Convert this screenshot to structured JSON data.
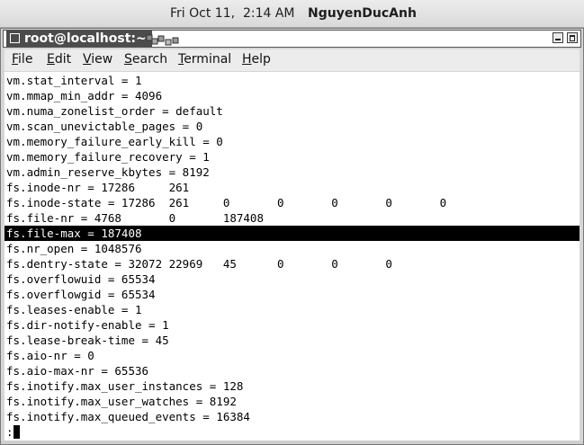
{
  "top_panel": {
    "clock": "Fri Oct 11,  2:14 AM",
    "username": "NguyenDucAnh"
  },
  "window": {
    "title": "root@localhost:~",
    "menu": [
      {
        "mnemonic": "F",
        "rest": "ile"
      },
      {
        "mnemonic": "E",
        "rest": "dit"
      },
      {
        "mnemonic": "V",
        "rest": "iew"
      },
      {
        "mnemonic": "S",
        "rest": "earch"
      },
      {
        "mnemonic": "T",
        "rest": "erminal"
      },
      {
        "mnemonic": "H",
        "rest": "elp"
      }
    ]
  },
  "terminal": {
    "lines": [
      "vm.stat_interval = 1",
      "vm.mmap_min_addr = 4096",
      "vm.numa_zonelist_order = default",
      "vm.scan_unevictable_pages = 0",
      "vm.memory_failure_early_kill = 0",
      "vm.memory_failure_recovery = 1",
      "vm.admin_reserve_kbytes = 8192",
      "fs.inode-nr = 17286     261",
      "fs.inode-state = 17286  261     0       0       0       0       0",
      "fs.file-nr = 4768       0       187408",
      "fs.file-max = 187408",
      "fs.nr_open = 1048576",
      "fs.dentry-state = 32072 22969   45      0       0       0",
      "fs.overflowuid = 65534",
      "fs.overflowgid = 65534",
      "fs.leases-enable = 1",
      "fs.dir-notify-enable = 1",
      "fs.lease-break-time = 45",
      "fs.aio-nr = 0",
      "fs.aio-max-nr = 65536",
      "fs.inotify.max_user_instances = 128",
      "fs.inotify.max_user_watches = 8192",
      "fs.inotify.max_queued_events = 16384"
    ],
    "highlighted_line_index": 10,
    "prompt": ":"
  }
}
